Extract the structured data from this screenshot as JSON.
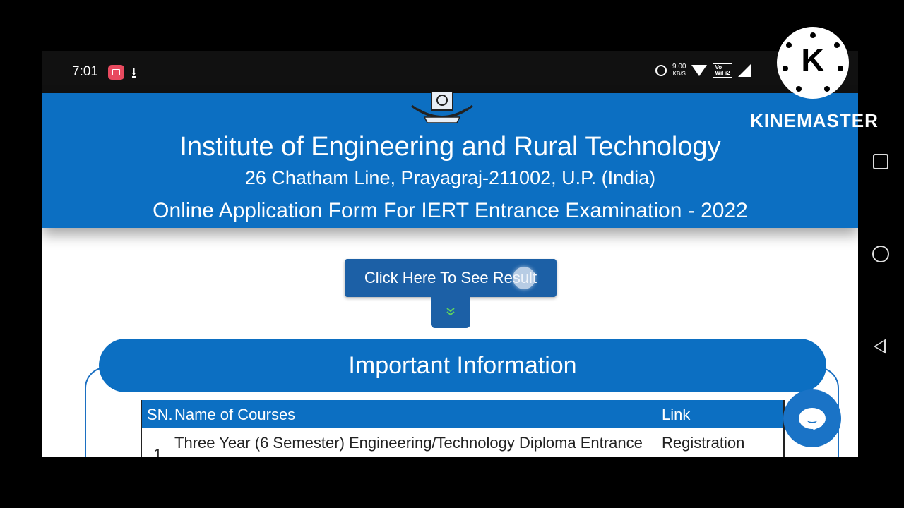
{
  "status_bar": {
    "time": "7:01",
    "network_speed": "9.00",
    "network_speed_unit": "KB/S",
    "volte_label": "Vo LTE WiFi 2"
  },
  "header": {
    "title": "Institute of Engineering and Rural Technology",
    "address": "26 Chatham Line, Prayagraj-211002, U.P. (India)",
    "form_title": "Online Application Form For IERT Entrance Examination - 2022",
    "background_color": "#0c6fc2"
  },
  "result_button": {
    "label": "Click Here To See Result"
  },
  "important_info": {
    "title": "Important Information",
    "table": {
      "headers": {
        "sn": "SN.",
        "name": "Name of Courses",
        "link": "Link"
      },
      "rows": [
        {
          "sn": "1",
          "name": "Three Year (6 Semester) Engineering/Technology Diploma Entrance",
          "link": "Registration"
        }
      ]
    }
  },
  "watermark": {
    "logo_letter": "K",
    "text": "KINEMASTER"
  },
  "icons": {
    "status": [
      "screen-record-icon",
      "download-icon",
      "alarm-icon",
      "wifi-icon",
      "volte-icon",
      "signal-icon"
    ],
    "nav": [
      "recents-icon",
      "home-icon",
      "back-icon"
    ],
    "other": [
      "emblem-icon",
      "double-chevron-down-icon",
      "chat-icon"
    ]
  }
}
